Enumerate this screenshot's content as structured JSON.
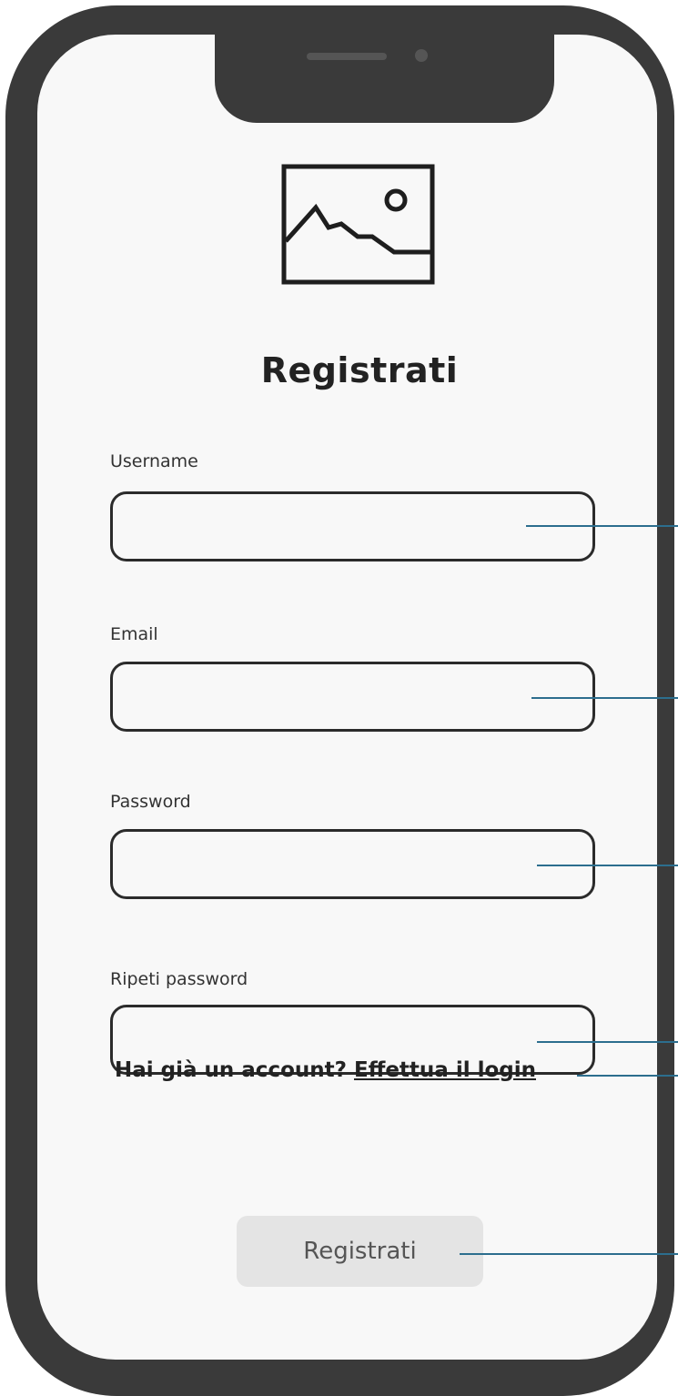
{
  "screen": {
    "title": "Registrati",
    "logo_icon": "image-placeholder-icon"
  },
  "form": {
    "fields": [
      {
        "label": "Username",
        "value": ""
      },
      {
        "label": "Email",
        "value": ""
      },
      {
        "label": "Password",
        "value": ""
      },
      {
        "label": "Ripeti password",
        "value": ""
      }
    ],
    "account_prompt": "Hai già un account?",
    "login_link": "Effettua il login",
    "submit_label": "Registrati"
  },
  "colors": {
    "device_frame": "#3a3a3a",
    "screen_background": "#f8f8f8",
    "input_border": "#2b2b2b",
    "button_background": "#e4e4e4",
    "annotation_line": "#2c6e8e"
  }
}
